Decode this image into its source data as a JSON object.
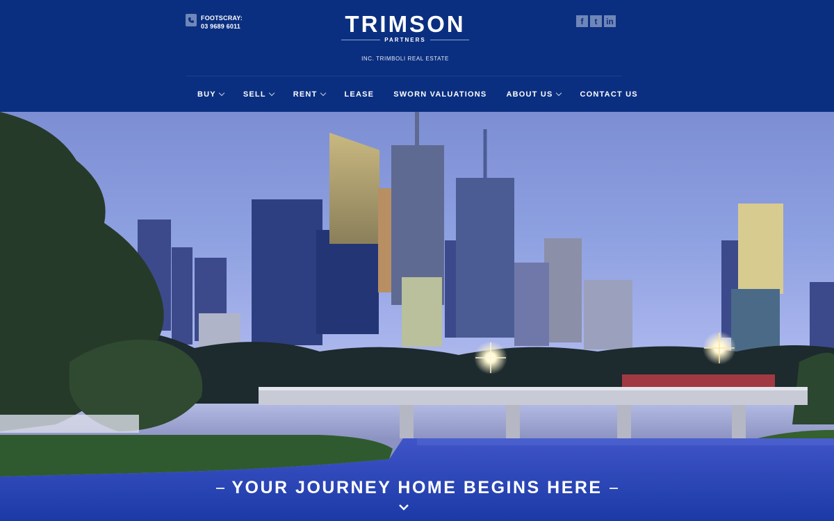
{
  "header": {
    "contact": {
      "location": "FOOTSCRAY:",
      "phone": "03 9689 6011",
      "icon": "phone-icon"
    },
    "brand": {
      "name": "TRIMSON",
      "sub": "PARTNERS",
      "inc": "INC. TRIMBOLI REAL ESTATE"
    },
    "social": [
      {
        "label": "f",
        "icon": "facebook-icon"
      },
      {
        "label": "t",
        "icon": "twitter-icon"
      },
      {
        "label": "in",
        "icon": "linkedin-icon"
      }
    ],
    "nav": [
      {
        "label": "BUY",
        "dropdown": true
      },
      {
        "label": "SELL",
        "dropdown": true
      },
      {
        "label": "RENT",
        "dropdown": true
      },
      {
        "label": "LEASE",
        "dropdown": false
      },
      {
        "label": "SWORN VALUATIONS",
        "dropdown": false
      },
      {
        "label": "ABOUT US",
        "dropdown": true
      },
      {
        "label": "CONTACT US",
        "dropdown": false
      }
    ]
  },
  "hero": {
    "tagline": "YOUR JOURNEY HOME BEGINS HERE",
    "scroll_icon": "chevron-down-icon"
  },
  "colors": {
    "header_bg": "#0b2f80",
    "accent_box": "#6f86b8",
    "text": "#ffffff"
  }
}
